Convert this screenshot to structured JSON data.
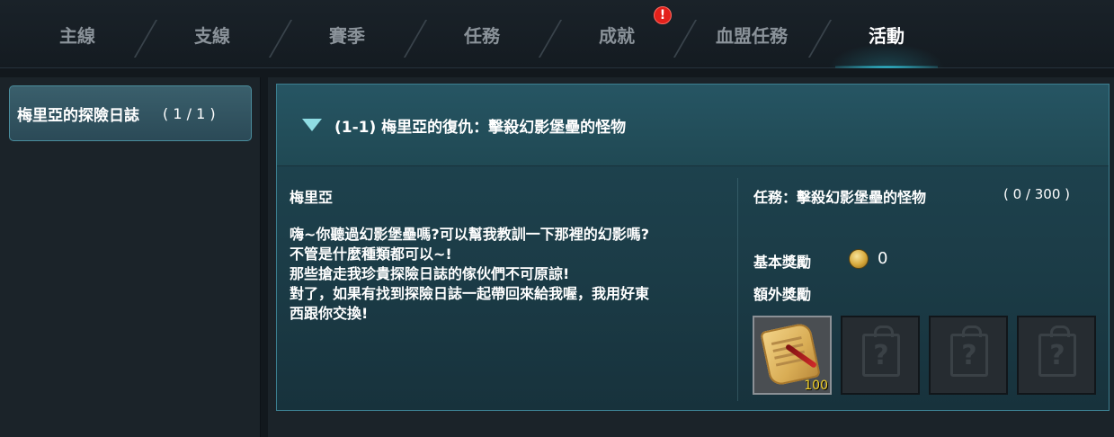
{
  "tabs": [
    {
      "label": "主線",
      "active": false
    },
    {
      "label": "支線",
      "active": false
    },
    {
      "label": "賽季",
      "active": false
    },
    {
      "label": "任務",
      "active": false
    },
    {
      "label": "成就",
      "active": false,
      "alert": true
    },
    {
      "label": "血盟任務",
      "active": false
    },
    {
      "label": "活動",
      "active": true
    }
  ],
  "alert_badge": "!",
  "quest_list": [
    {
      "title": "梅里亞的探險日誌",
      "count": "( 1 / 1 )"
    }
  ],
  "quest": {
    "header": "(1-1) 梅里亞的復仇：擊殺幻影堡壘的怪物",
    "npc": "梅里亞",
    "dialogue": [
      "嗨~你聽過幻影堡壘嗎?可以幫我教訓一下那裡的幻影嗎?",
      "不管是什麼種類都可以~!",
      "那些搶走我珍貴探險日誌的傢伙們不可原諒!",
      "對了，如果有找到探險日誌一起帶回來給我喔，我用好東",
      "西跟你交換!"
    ],
    "task_label": "任務：擊殺幻影堡壘的怪物",
    "task_progress": "( 0 / 300 )",
    "basic_reward_label": "基本獎勵",
    "basic_reward_value": "0",
    "extra_reward_label": "額外獎勵",
    "reward_slots": [
      {
        "item": "scroll-quill-icon",
        "quantity": "100"
      },
      {
        "item": "mystery-gift-icon",
        "quantity": ""
      },
      {
        "item": "mystery-gift-icon",
        "quantity": ""
      },
      {
        "item": "mystery-gift-icon",
        "quantity": ""
      }
    ]
  },
  "colors": {
    "accent": "#33d2ea",
    "panel_border": "#3c7f90",
    "alert": "#e3211b",
    "quantity": "#f5d32b"
  }
}
